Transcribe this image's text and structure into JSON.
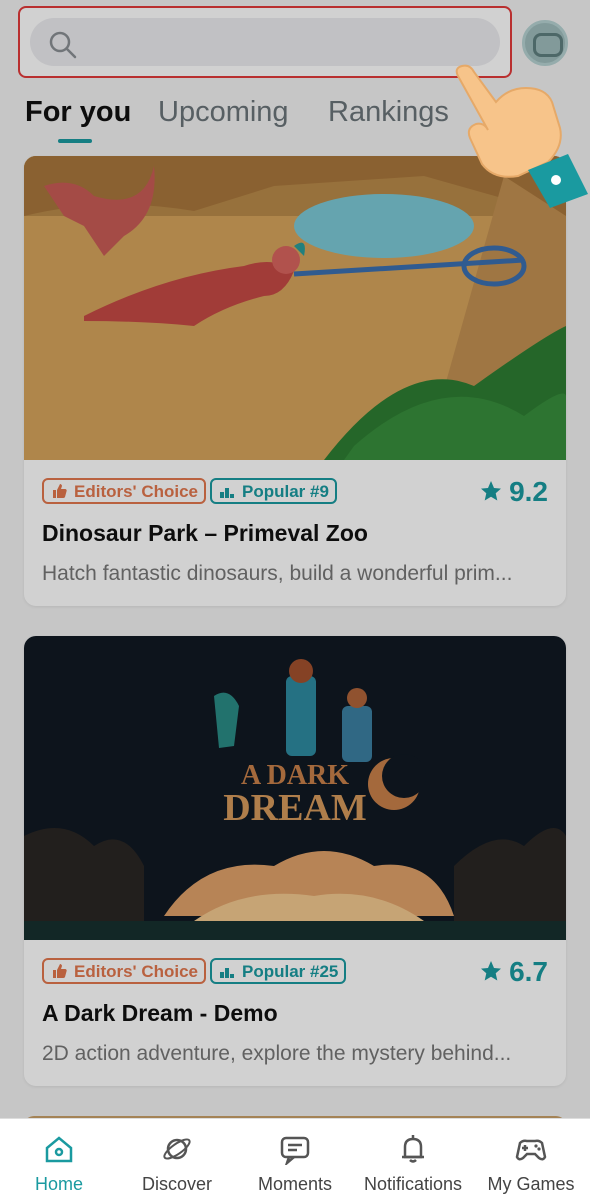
{
  "search": {
    "placeholder": "",
    "value": ""
  },
  "tabs": [
    {
      "label": "For you",
      "active": true
    },
    {
      "label": "Upcoming",
      "active": false
    },
    {
      "label": "Rankings",
      "active": false
    }
  ],
  "games": [
    {
      "badges": {
        "editors": "Editors' Choice",
        "popular": "Popular #9"
      },
      "rating": "9.2",
      "title": "Dinosaur Park – Primeval Zoo",
      "description": "Hatch fantastic dinosaurs, build a wonderful prim..."
    },
    {
      "badges": {
        "editors": "Editors' Choice",
        "popular": "Popular #25"
      },
      "rating": "6.7",
      "title": "A Dark Dream - Demo",
      "description": "2D action adventure, explore the mystery behind...",
      "art_text_top": "A DARK",
      "art_text_bottom": "DREAM"
    }
  ],
  "bottom_nav": [
    {
      "label": "Home",
      "icon": "home-icon",
      "active": true
    },
    {
      "label": "Discover",
      "icon": "planet-icon",
      "active": false
    },
    {
      "label": "Moments",
      "icon": "moments-icon",
      "active": false
    },
    {
      "label": "Notifications",
      "icon": "bell-icon",
      "active": false
    },
    {
      "label": "My Games",
      "icon": "gamepad-icon",
      "active": false
    }
  ],
  "colors": {
    "accent": "#1a9aa0",
    "editors_badge": "#e2774e",
    "highlight_border": "#e23a3a"
  }
}
